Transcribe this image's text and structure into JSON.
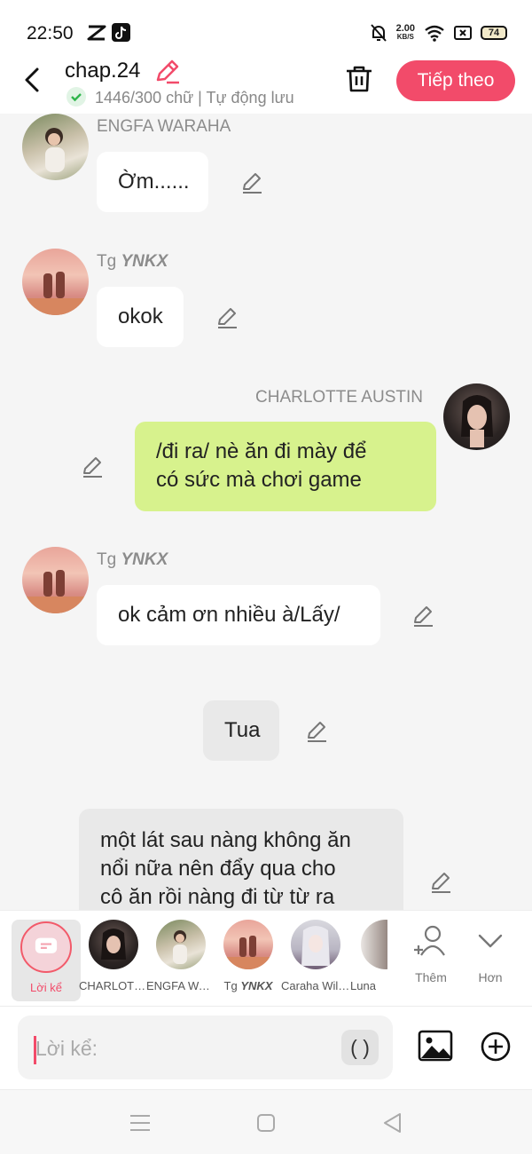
{
  "status": {
    "time": "22:50",
    "speed_value": "2.00",
    "speed_unit": "KB/S",
    "battery": "74"
  },
  "header": {
    "title": "chap.24",
    "subtitle": "1446/300 chữ | Tự động lưu",
    "next_label": "Tiếp theo",
    "accent_color": "#f24b6a"
  },
  "messages": [
    {
      "side": "left",
      "name": "ENGFA WARAHA",
      "text": "Ờm......"
    },
    {
      "side": "left",
      "name_prefix": "Tg",
      "name_italic": "YNKX",
      "text": "okok"
    },
    {
      "side": "right",
      "name": "CHARLOTTE AUSTIN",
      "text_lines": [
        "/đi ra/ nè ăn đi mày để",
        "có sức mà chơi game"
      ]
    },
    {
      "side": "left",
      "name_prefix": "Tg",
      "name_italic": "YNKX",
      "text": "ok cảm ơn nhiều à/Lấy/"
    },
    {
      "side": "center",
      "text": "Tua"
    },
    {
      "side": "narration",
      "text_lines": [
        "một lát sau nàng không ăn",
        "nổi nữa nên đẩy qua cho",
        "cô ăn rồi nàng đi từ từ ra"
      ]
    }
  ],
  "characters": [
    {
      "label": "Lời kể",
      "selected": true
    },
    {
      "label": "CHARLOTTE AUSTIN"
    },
    {
      "label": "ENGFA WARAHA"
    },
    {
      "label_prefix": "Tg",
      "label_italic": "YNKX"
    },
    {
      "label": "Caraha Williams"
    },
    {
      "label": "Luna"
    }
  ],
  "bar_actions": {
    "more_label": "Thêm",
    "expand_label": "Hơn"
  },
  "input": {
    "placeholder": "Lời kể:",
    "paren_label": "( )"
  }
}
